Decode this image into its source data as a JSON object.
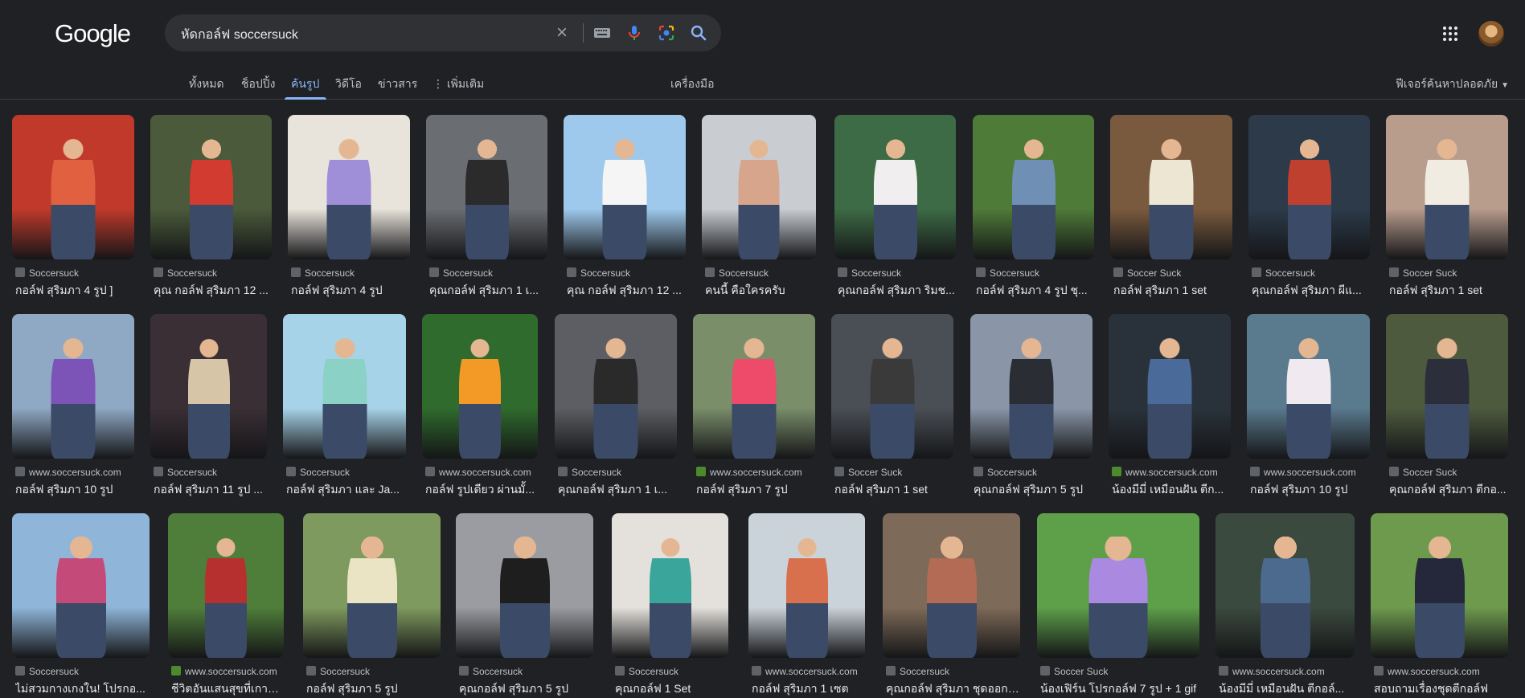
{
  "header": {
    "logo": "Google",
    "query": "หัดกอล์ฟ soccersuck",
    "clear_icon": "close-icon",
    "keyboard_icon": "keyboard-icon",
    "mic_icon": "mic-icon",
    "lens_icon": "lens-icon",
    "search_icon": "search-icon"
  },
  "tabs": [
    {
      "label": "ทั้งหมด"
    },
    {
      "label": "ช็อปปิ้ง"
    },
    {
      "label": "ค้นรูป"
    },
    {
      "label": "วิดีโอ"
    },
    {
      "label": "ข่าวสาร"
    },
    {
      "label": "⋮ เพิ่มเติม"
    }
  ],
  "tools_label": "เครื่องมือ",
  "safesearch_label": "ฟีเจอร์ค้นหาปลอดภัย",
  "colors": {
    "background": "#202124",
    "accent": "#8ab4f8"
  },
  "rows": [
    [
      {
        "source": "Soccersuck",
        "title": "กอล์ฟ สุริมภา 4 รูป ]",
        "bg": "#c0392b",
        "fig": "#e06040"
      },
      {
        "source": "Soccersuck",
        "title": "คุณ กอล์ฟ สุริมภา 12 ...",
        "bg": "#4a5a3a",
        "fig": "#d23b2f"
      },
      {
        "source": "Soccersuck",
        "title": "กอล์ฟ สุริมภา 4 รูป",
        "bg": "#e8e3db",
        "fig": "#9f8fd8"
      },
      {
        "source": "Soccersuck",
        "title": "คุณกอล์ฟ สุริมภา 1 เ...",
        "bg": "#6a6e73",
        "fig": "#2b2b2b"
      },
      {
        "source": "Soccersuck",
        "title": "คุณ กอล์ฟ สุริมภา 12 ...",
        "bg": "#9ec9ec",
        "fig": "#f5f5f5"
      },
      {
        "source": "Soccersuck",
        "title": "คนนี้ คือใครครับ",
        "bg": "#c9cdd2",
        "fig": "#d7a48c"
      },
      {
        "source": "Soccersuck",
        "title": "คุณกอล์ฟ สุริมภา ริมช...",
        "bg": "#3d6b45",
        "fig": "#f0eeee"
      },
      {
        "source": "Soccersuck",
        "title": "กอล์ฟ สุริมภา 4 รูป ชุ...",
        "bg": "#4f7b38",
        "fig": "#6f8fb4"
      },
      {
        "source": "Soccer Suck",
        "title": "กอล์ฟ สุริมภา 1 set",
        "bg": "#7a5a3e",
        "fig": "#ece6d2"
      },
      {
        "source": "Soccersuck",
        "title": "คุณกอล์ฟ สุริมภา ผีแ...",
        "bg": "#2c3a4a",
        "fig": "#c0402f"
      },
      {
        "source": "Soccer Suck",
        "title": "กอล์ฟ สุริมภา 1 set",
        "bg": "#b89c8c",
        "fig": "#f1ece2"
      }
    ],
    [
      {
        "source": "www.soccersuck.com",
        "title": "กอล์ฟ สุริมภา 10 รูป",
        "bg": "#8fa8c4",
        "fig": "#7c54b8"
      },
      {
        "source": "Soccersuck",
        "title": "กอล์ฟ สุริมภา 11 รูป ...",
        "bg": "#3a2f34",
        "fig": "#d7c5a8"
      },
      {
        "source": "Soccersuck",
        "title": "กอล์ฟ สุริมภา และ Ja...",
        "bg": "#a7d3e8",
        "fig": "#8cd1c6"
      },
      {
        "source": "www.soccersuck.com",
        "title": "กอล์ฟ รูปเดียว ผ่านมั้...",
        "bg": "#2f6b2c",
        "fig": "#f39a26"
      },
      {
        "source": "Soccersuck",
        "title": "คุณกอล์ฟ สุริมภา 1 เ...",
        "bg": "#5c5e63",
        "fig": "#2a2a2a"
      },
      {
        "source": "www.soccersuck.com",
        "title": "กอล์ฟ สุริมภา 7 รูป",
        "bg": "#7a8e6a",
        "fig": "#ee4a6a"
      },
      {
        "source": "Soccer Suck",
        "title": "กอล์ฟ สุริมภา 1 set",
        "bg": "#4a4f55",
        "fig": "#3a3a3a"
      },
      {
        "source": "Soccersuck",
        "title": "คุณกอล์ฟ สุริมภา 5 รูป",
        "bg": "#8a96a8",
        "fig": "#2a2d33"
      },
      {
        "source": "www.soccersuck.com",
        "title": "น้องมีมี่ เหมือนฝัน ตีก...",
        "bg": "#29323b",
        "fig": "#4a6a9a"
      },
      {
        "source": "www.soccersuck.com",
        "title": "กอล์ฟ สุริมภา 10 รูป",
        "bg": "#5a7a8e",
        "fig": "#f0eaf0"
      },
      {
        "source": "Soccer Suck",
        "title": "คุณกอล์ฟ สุริมภา ตีกอ...",
        "bg": "#4d5a3e",
        "fig": "#2c2f3b"
      }
    ],
    [
      {
        "source": "Soccersuck",
        "title": "ไม่สวมกางเกงใน! โปรกอ...",
        "bg": "#8fb5d9",
        "fig": "#c44a7a"
      },
      {
        "source": "www.soccersuck.com",
        "title": "ชีวิตอันแสนสุขที่เกาห...",
        "bg": "#4f7e3a",
        "fig": "#b5302e"
      },
      {
        "source": "Soccersuck",
        "title": "กอล์ฟ สุริมภา 5 รูป",
        "bg": "#7f9a5e",
        "fig": "#eae3c4"
      },
      {
        "source": "Soccersuck",
        "title": "คุณกอล์ฟ สุริมภา 5 รูป",
        "bg": "#9a9ca2",
        "fig": "#1e1e1e"
      },
      {
        "source": "Soccersuck",
        "title": "คุณกอล์ฟ 1 Set",
        "bg": "#e4e1dc",
        "fig": "#3aa59a"
      },
      {
        "source": "www.soccersuck.com",
        "title": "กอล์ฟ สุริมภา 1 เซต",
        "bg": "#cbd3da",
        "fig": "#d9704d"
      },
      {
        "source": "Soccersuck",
        "title": "คุณกอล์ฟ สุริมภา ชุดออกกำ...",
        "bg": "#7e6a58",
        "fig": "#b36b55"
      },
      {
        "source": "Soccer Suck",
        "title": "น้องเฟิร์น โปรกอล์ฟ 7 รูป + 1 gif",
        "bg": "#5ea04a",
        "fig": "#a98ae0"
      },
      {
        "source": "www.soccersuck.com",
        "title": "น้องมีมี่ เหมือนฝัน ตีกอล์...",
        "bg": "#3b4a3e",
        "fig": "#4b6a8e"
      },
      {
        "source": "www.soccersuck.com",
        "title": "สอบถามเรื่องชุดตีกอล์ฟ",
        "bg": "#6e9a4e",
        "fig": "#24283a"
      }
    ]
  ]
}
